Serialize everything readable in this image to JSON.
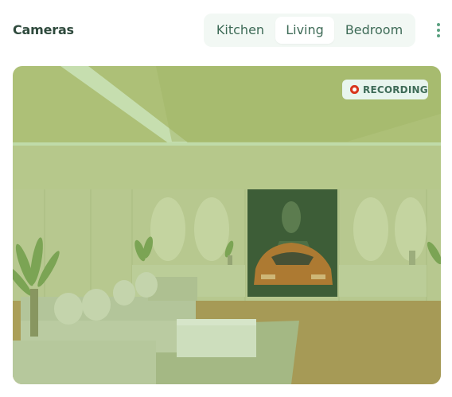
{
  "header": {
    "title": "Cameras",
    "tabs": [
      {
        "label": "Kitchen",
        "selected": false
      },
      {
        "label": "Living",
        "selected": true
      },
      {
        "label": "Bedroom",
        "selected": false
      }
    ],
    "menu_icon": "more-vertical-icon"
  },
  "feed": {
    "status_label": "RECORDING",
    "status_icon": "record-dot-icon",
    "status_color": "#d9381e"
  },
  "colors": {
    "accent": "#5aa080",
    "title": "#2f4a3d",
    "tab_bg": "#f2f8f4",
    "tab_selected_bg": "#ffffff"
  }
}
